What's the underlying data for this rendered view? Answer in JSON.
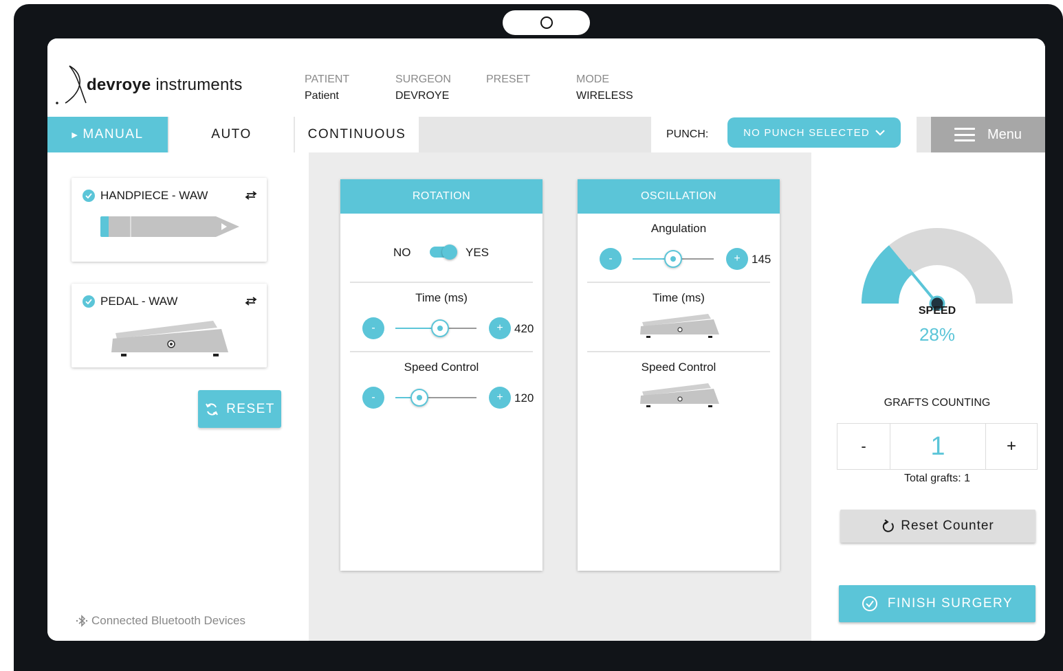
{
  "brand": {
    "name_bold": "devroye",
    "name_light": "instruments"
  },
  "header": {
    "fields": [
      {
        "key": "PATIENT",
        "value": "Patient"
      },
      {
        "key": "SURGEON",
        "value": "DEVROYE"
      },
      {
        "key": "PRESET",
        "value": ""
      },
      {
        "key": "MODE",
        "value": "WIRELESS"
      }
    ]
  },
  "nav": {
    "tabs": [
      {
        "label": "MANUAL",
        "active": true
      },
      {
        "label": "AUTO",
        "active": false
      },
      {
        "label": "CONTINUOUS",
        "active": false
      }
    ],
    "punch_label": "PUNCH:",
    "punch_value": "NO PUNCH SELECTED",
    "menu_label": "Menu"
  },
  "devices": [
    {
      "name": "HANDPIECE - WAW",
      "icon": "handpiece-icon",
      "connected": true
    },
    {
      "name": "PEDAL - WAW",
      "icon": "pedal-icon",
      "connected": true
    }
  ],
  "reset_label": "RESET",
  "bluetooth_label": "Connected Bluetooth Devices",
  "rotation": {
    "title": "ROTATION",
    "toggle": {
      "off_label": "NO",
      "on_label": "YES",
      "enabled": true
    },
    "time": {
      "label": "Time (ms)",
      "value": "420",
      "fraction": 0.55
    },
    "speed": {
      "label": "Speed Control",
      "value": "120",
      "fraction": 0.3
    }
  },
  "oscillation": {
    "title": "OSCILLATION",
    "angulation": {
      "label": "Angulation",
      "value": "145",
      "fraction": 0.5
    },
    "time": {
      "label": "Time (ms)",
      "icon": "pedal-icon"
    },
    "speed": {
      "label": "Speed Control",
      "icon": "pedal-icon"
    }
  },
  "speed_gauge": {
    "label": "SPEED",
    "value": "28%",
    "fraction": 0.28
  },
  "grafts": {
    "title": "GRAFTS COUNTING",
    "minus": "-",
    "count": "1",
    "plus": "+",
    "total_label": "Total grafts: 1"
  },
  "reset_counter_label": "Reset Counter",
  "finish_label": "FINISH SURGERY",
  "colors": {
    "accent": "#5bc5d8",
    "gauge_track": "#d9d9d9",
    "frame": "#111418"
  }
}
